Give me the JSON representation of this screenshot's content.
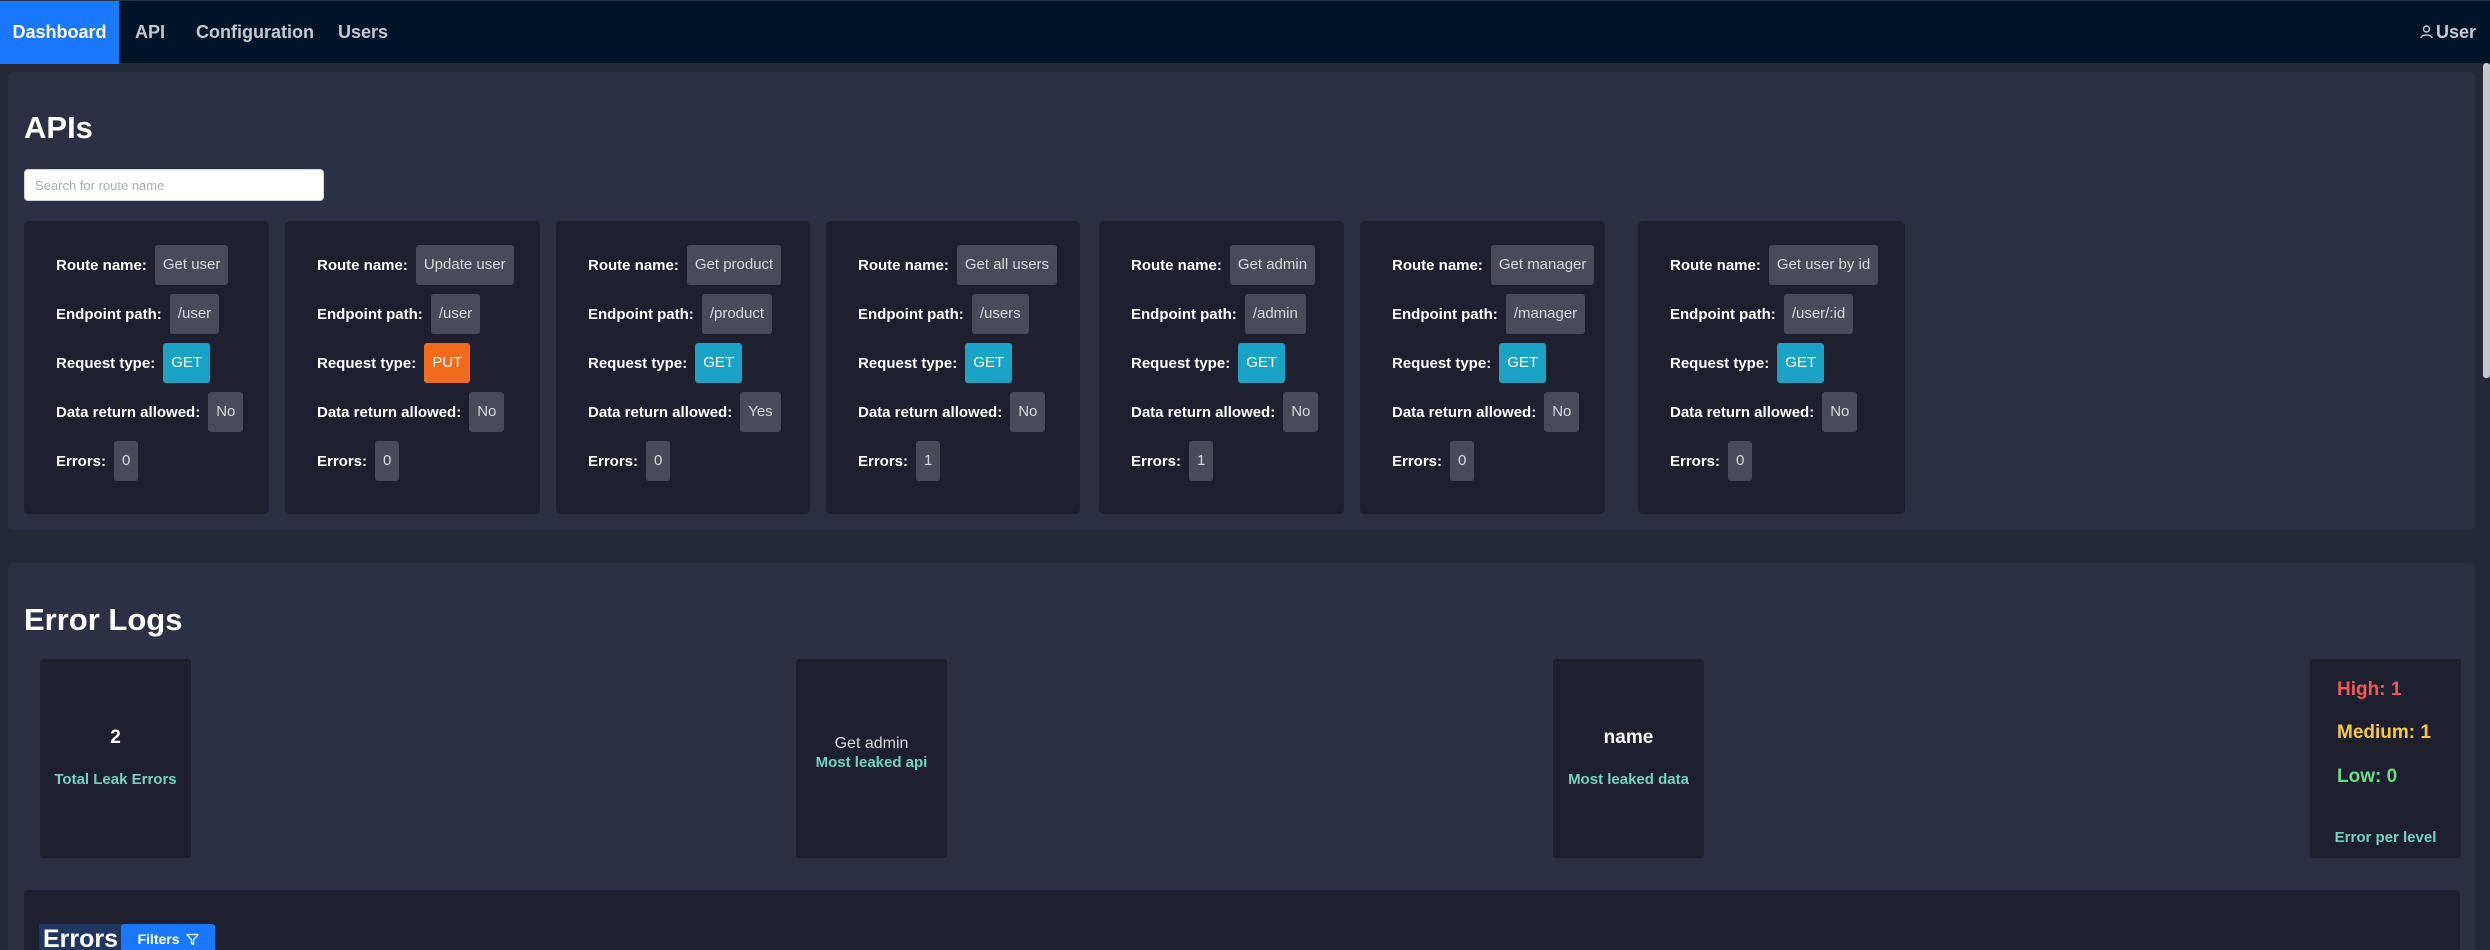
{
  "nav": {
    "items": [
      {
        "label": "Dashboard"
      },
      {
        "label": "API"
      },
      {
        "label": "Configuration"
      },
      {
        "label": "Users"
      }
    ],
    "user_label": "User",
    "active_color": "#1978ff"
  },
  "apis": {
    "title": "APIs",
    "search_placeholder": "Search for route name",
    "labels": {
      "route_name": "Route name:",
      "endpoint_path": "Endpoint path:",
      "request_type": "Request type:",
      "data_return": "Data return allowed:",
      "errors": "Errors:"
    },
    "cards": [
      {
        "route": "Get user",
        "path": "/user",
        "method": "GET",
        "data_return": "No",
        "errors": "0"
      },
      {
        "route": "Update user",
        "path": "/user",
        "method": "PUT",
        "data_return": "No",
        "errors": "0"
      },
      {
        "route": "Get product",
        "path": "/product",
        "method": "GET",
        "data_return": "Yes",
        "errors": "0"
      },
      {
        "route": "Get all users",
        "path": "/users",
        "method": "GET",
        "data_return": "No",
        "errors": "1"
      },
      {
        "route": "Get admin",
        "path": "/admin",
        "method": "GET",
        "data_return": "No",
        "errors": "1"
      },
      {
        "route": "Get manager",
        "path": "/manager",
        "method": "GET",
        "data_return": "No",
        "errors": "0"
      },
      {
        "route": "Get user by id",
        "path": "/user/:id",
        "method": "GET",
        "data_return": "No",
        "errors": "0"
      }
    ],
    "method_colors": {
      "GET": "#1ba3c6",
      "PUT": "#f26b1d"
    }
  },
  "error_logs": {
    "title": "Error Logs",
    "total": {
      "value": "2",
      "label": "Total Leak Errors"
    },
    "most_leaked_api": {
      "value": "Get admin",
      "label": "Most leaked api"
    },
    "most_leaked_data": {
      "value": "name",
      "label": "Most leaked data"
    },
    "levels": {
      "high": "High: 1",
      "medium": "Medium: 1",
      "low": "Low: 0",
      "label": "Error per level",
      "colors": {
        "high": "#f05a5a",
        "medium": "#f5c944",
        "low": "#6fd98a"
      }
    }
  },
  "errors": {
    "title": "Errors",
    "filters_label": "Filters"
  }
}
